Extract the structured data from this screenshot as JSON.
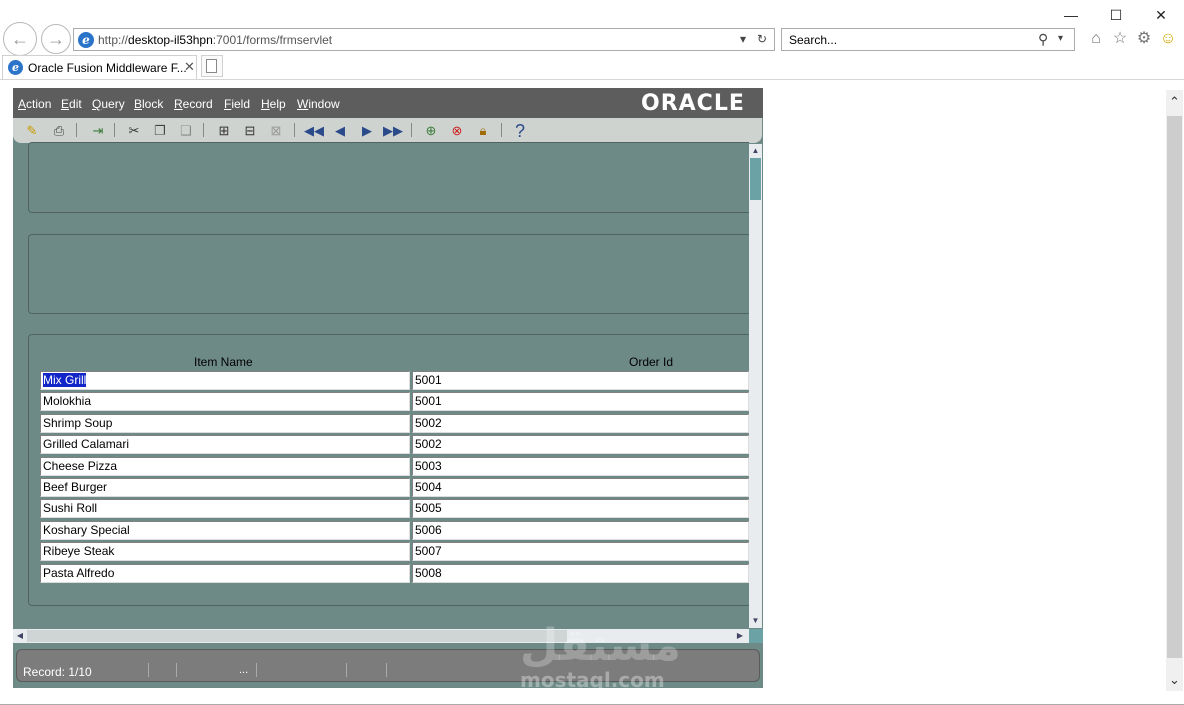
{
  "browser": {
    "window_controls": {
      "minimize": "—",
      "maximize": "☐",
      "close": "✕"
    },
    "url_prefix": "http://",
    "url_host": "desktop-il53hpn",
    "url_rest": ":7001/forms/frmservlet",
    "search_placeholder": "Search...",
    "tab_title": "Oracle Fusion Middleware F...",
    "tab_close": "✕"
  },
  "oracle": {
    "logo": "ORACLE",
    "menu": [
      "Action",
      "Edit",
      "Query",
      "Block",
      "Record",
      "Field",
      "Help",
      "Window"
    ],
    "menu_accel": [
      "A",
      "E",
      "Q",
      "B",
      "R",
      "F",
      "H",
      "W"
    ],
    "table": {
      "col_item": "Item Name",
      "col_order": "Order Id",
      "rows": [
        {
          "item": "Mix Grill",
          "order": "5001"
        },
        {
          "item": "Molokhia",
          "order": "5001"
        },
        {
          "item": "Shrimp Soup",
          "order": "5002"
        },
        {
          "item": "Grilled Calamari",
          "order": "5002"
        },
        {
          "item": "Cheese Pizza",
          "order": "5003"
        },
        {
          "item": "Beef Burger",
          "order": "5004"
        },
        {
          "item": "Sushi Roll",
          "order": "5005"
        },
        {
          "item": "Koshary Special",
          "order": "5006"
        },
        {
          "item": "Ribeye Steak",
          "order": "5007"
        },
        {
          "item": "Pasta Alfredo",
          "order": "5008"
        }
      ]
    },
    "status": {
      "record": "Record: 1/10",
      "ellipsis": "..."
    }
  },
  "watermark": {
    "arabic": "مستقل",
    "latin": "mostaql.com"
  },
  "colors": {
    "form_bg": "#6e8a87",
    "menubar": "#5d5d5d",
    "selection": "#1226c8"
  }
}
